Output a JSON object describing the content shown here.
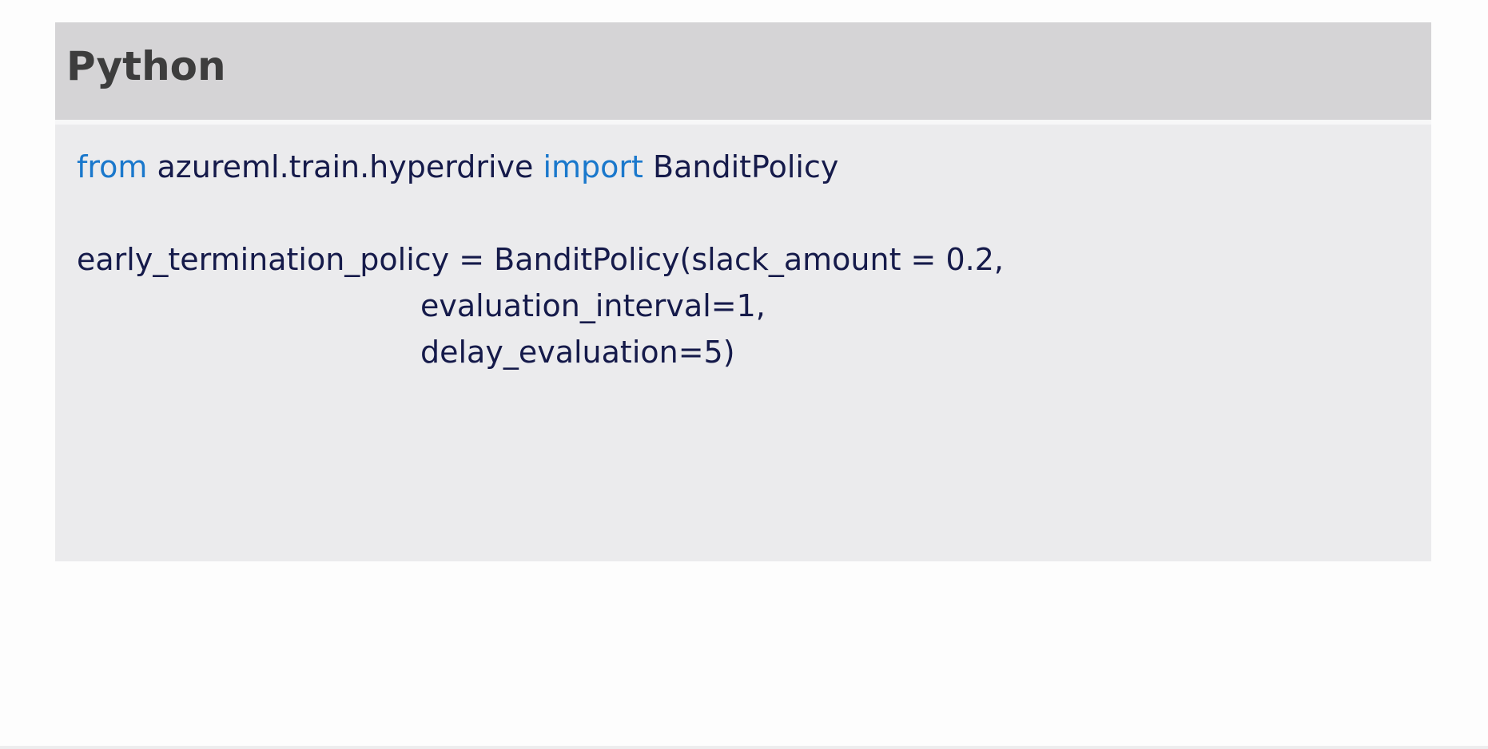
{
  "header": {
    "title": "Python"
  },
  "code": {
    "line1": {
      "kw_from": "from",
      "module": " azureml.train.hyperdrive ",
      "kw_import": "import",
      "name": " BanditPolicy"
    },
    "line3": "early_termination_policy = BanditPolicy(slack_amount = 0.2,",
    "line4": "evaluation_interval=1,",
    "line5": "delay_evaluation=5)"
  },
  "colors": {
    "header_bg": "#d5d4d6",
    "body_bg": "#ebebed",
    "keyword": "#1a78cc",
    "code_text": "#151a4a",
    "title_text": "#3d3d3d"
  }
}
